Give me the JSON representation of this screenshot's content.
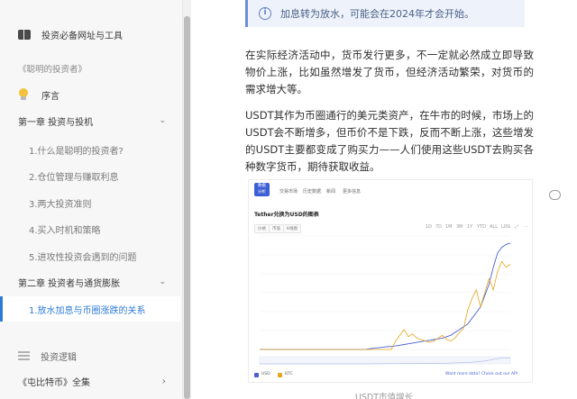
{
  "sidebar": {
    "items": [
      {
        "label": "投资必备网址与工具"
      },
      {
        "label": "《聪明的投资者》"
      },
      {
        "label": "序言"
      },
      {
        "label": "第一章 投资与投机"
      },
      {
        "label": "1.什么是聪明的投资者?"
      },
      {
        "label": "2.仓位管理与赚取利息"
      },
      {
        "label": "3.两大投资准则"
      },
      {
        "label": "4.买入时机和策略"
      },
      {
        "label": "5.进攻性投资会遇到的问题"
      },
      {
        "label": "第二章 投资者与通货膨胀"
      },
      {
        "label": "1.放水加息与币圈涨跌的关系"
      },
      {
        "label": "投资逻辑"
      },
      {
        "label": "《屯比特币》全集"
      }
    ]
  },
  "content": {
    "callout": "加息转为放水，可能会在2024年才会开始。",
    "para1": "在实际经济活动中，货币发行更多，不一定就必然成立即导致物价上涨，比如虽然增发了货币，但经济活动繁荣，对货币的需求增大等。",
    "para2": "USDT其作为币圈通行的美元类资产，在牛市的时候，市场上的USDT会不断增多，但币价不是下跌，反而不断上涨，这些增发的USDT主要都变成了购买力——人们使用这些USDT去购买各种数字货币，期待获取收益。",
    "caption": "USDT市值增长"
  },
  "embedded": {
    "logo": "数据\n分析",
    "nav": [
      "交易市场",
      "历史数据",
      "新闻",
      "更多信息"
    ],
    "title": "Tether兑换为USD的图表",
    "ranges": [
      "价格",
      "市值",
      "K线图"
    ],
    "tools": [
      "1D",
      "7D",
      "1M",
      "3M",
      "1Y",
      "YTD",
      "ALL",
      "LOG",
      "⤢",
      "⋯"
    ],
    "legend": [
      "USD",
      "BTC"
    ],
    "footer_right": "Want more data? Check out our API",
    "colors": {
      "usdt": "#4a5fd0",
      "btc": "#e3a61c",
      "brand": "#3d5fd6"
    }
  },
  "chart_data": {
    "type": "line",
    "title": "Tether兑换为USD的图表",
    "x_count": 60,
    "series": [
      {
        "name": "USD",
        "color": "#4a5fd0",
        "values": [
          0,
          0,
          0,
          0,
          0,
          0,
          0,
          0,
          0,
          0,
          0,
          0,
          0,
          0,
          0,
          0,
          0,
          0,
          0,
          0,
          0,
          0,
          0,
          0,
          0,
          0,
          0.5,
          1,
          1.2,
          1.5,
          2,
          2,
          2.5,
          3,
          3.5,
          4,
          4.5,
          5,
          5.5,
          6,
          6.5,
          7,
          7.5,
          8,
          9,
          10,
          12,
          14,
          16,
          18,
          22,
          26,
          30,
          38,
          46,
          58,
          68,
          72,
          74,
          75
        ]
      },
      {
        "name": "BTC",
        "color": "#e3a61c",
        "values": [
          0,
          0,
          0,
          0,
          0,
          0,
          0,
          0,
          0,
          0,
          0,
          0,
          0,
          0,
          0,
          0,
          0,
          0,
          0,
          0,
          0,
          0,
          0,
          0,
          0,
          0,
          0,
          0,
          0,
          0,
          0,
          0,
          6,
          10,
          14,
          9,
          11,
          8,
          7,
          6,
          5,
          6,
          8,
          10,
          7,
          6,
          8,
          12,
          15,
          28,
          36,
          42,
          30,
          40,
          50,
          42,
          55,
          62,
          58,
          60
        ]
      }
    ]
  }
}
